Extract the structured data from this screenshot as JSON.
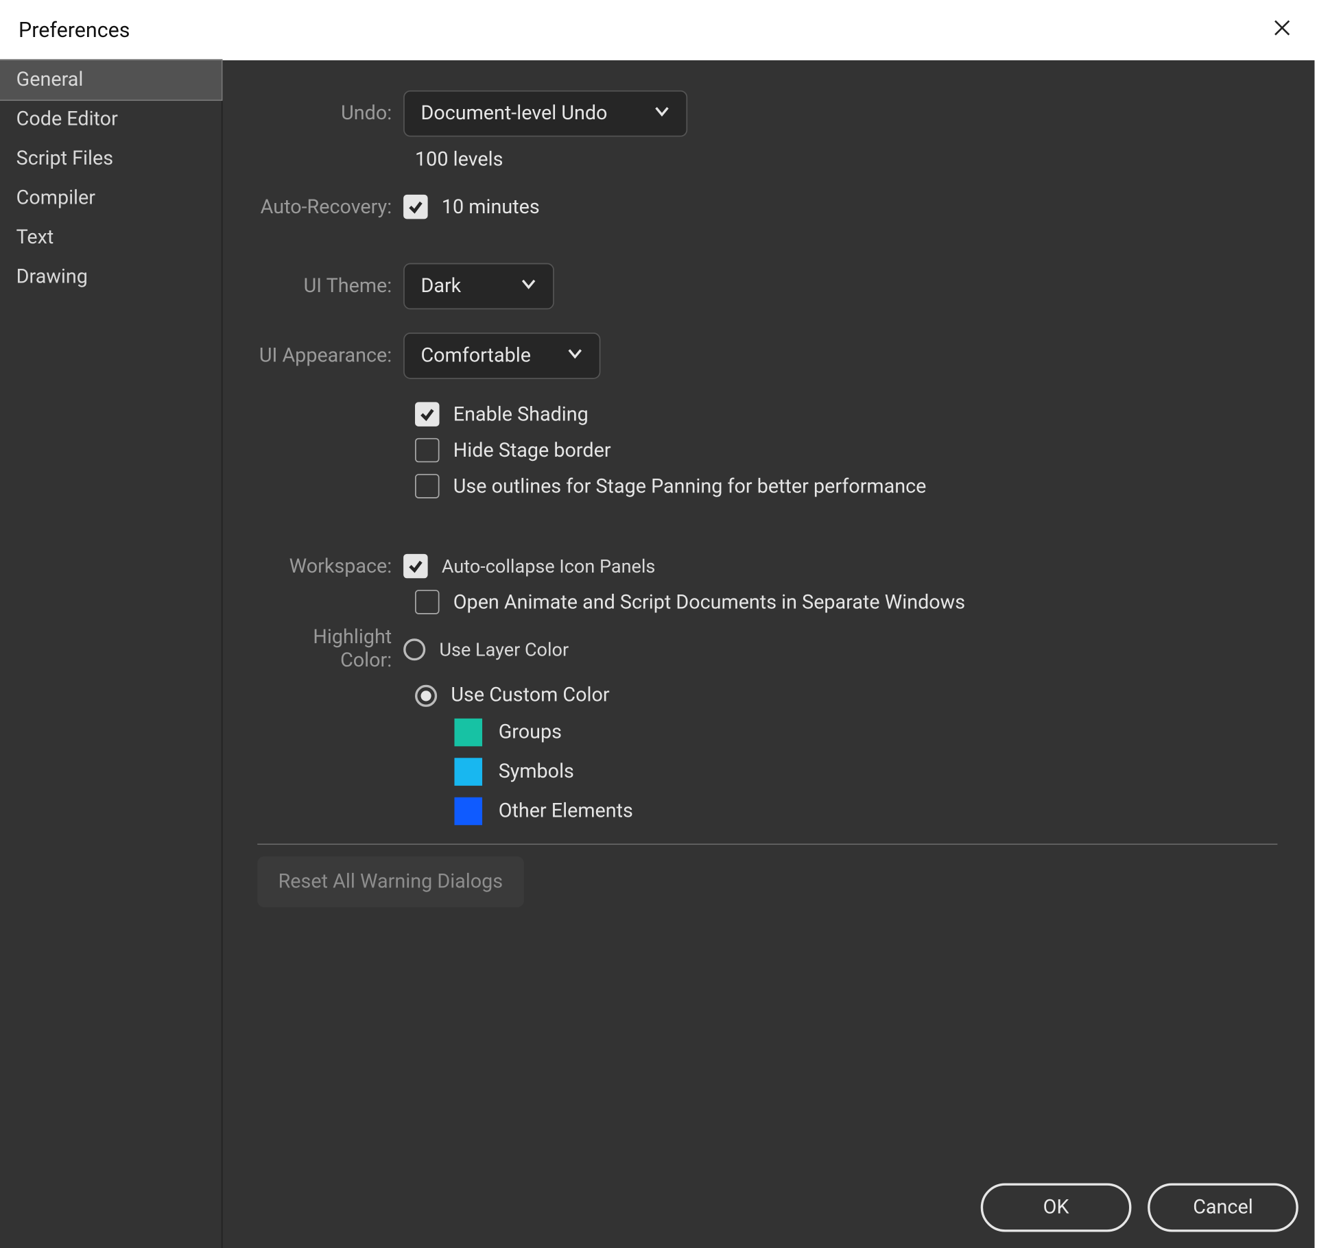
{
  "window": {
    "title": "Preferences"
  },
  "sidebar": {
    "items": [
      {
        "label": "General",
        "active": true
      },
      {
        "label": "Code Editor",
        "active": false
      },
      {
        "label": "Script Files",
        "active": false
      },
      {
        "label": "Compiler",
        "active": false
      },
      {
        "label": "Text",
        "active": false
      },
      {
        "label": "Drawing",
        "active": false
      }
    ]
  },
  "labels": {
    "undo": "Undo:",
    "auto_recovery": "Auto-Recovery:",
    "ui_theme": "UI Theme:",
    "ui_appearance": "UI Appearance:",
    "workspace": "Workspace:",
    "highlight_color": "Highlight Color:"
  },
  "undo": {
    "value": "Document-level Undo",
    "levels": "100 levels"
  },
  "auto_recovery": {
    "checked": true,
    "value": "10 minutes"
  },
  "ui_theme": {
    "value": "Dark"
  },
  "ui_appearance": {
    "value": "Comfortable"
  },
  "appearance_checks": {
    "enable_shading": {
      "checked": true,
      "label": "Enable Shading"
    },
    "hide_stage_border": {
      "checked": false,
      "label": "Hide Stage border"
    },
    "use_outlines": {
      "checked": false,
      "label": "Use outlines for Stage Panning for better performance"
    }
  },
  "workspace_checks": {
    "auto_collapse": {
      "checked": true,
      "label": "Auto-collapse Icon Panels"
    },
    "separate_windows": {
      "checked": false,
      "label": "Open Animate and Script Documents in Separate Windows"
    }
  },
  "highlight": {
    "use_layer": {
      "checked": false,
      "label": "Use Layer Color"
    },
    "use_custom": {
      "checked": true,
      "label": "Use Custom Color"
    },
    "groups": {
      "color": "#17c2a4",
      "label": "Groups"
    },
    "symbols": {
      "color": "#18b7f0",
      "label": "Symbols"
    },
    "other": {
      "color": "#0f5bff",
      "label": "Other Elements"
    }
  },
  "buttons": {
    "reset": "Reset All Warning Dialogs",
    "ok": "OK",
    "cancel": "Cancel"
  }
}
